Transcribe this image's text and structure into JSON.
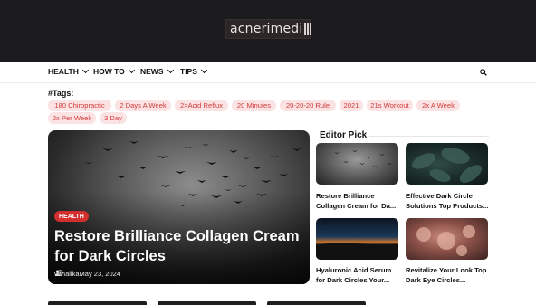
{
  "header": {
    "logo_text": "acnerimedi"
  },
  "nav": {
    "items": [
      {
        "label": "HEALTH"
      },
      {
        "label": "HOW TO"
      },
      {
        "label": "NEWS"
      },
      {
        "label": "TIPS"
      }
    ]
  },
  "tags": {
    "title": "#Tags:",
    "items": [
      "180 Chiropractic",
      "2 Days A Week",
      "2>Acid Reflux",
      "20 Minutes",
      "20-20-20 Rule",
      "2021",
      "21s Workout",
      "2x A Week",
      "2x Per Week",
      "3 Day"
    ]
  },
  "hero": {
    "category": "HEALTH",
    "title": "Restore Brilliance Collagen Cream for Dark Circles",
    "author": "vanalika",
    "date": "May 23, 2024"
  },
  "editor_pick": {
    "title": "Editor Pick",
    "cards": [
      {
        "title": "Restore Brilliance Collagen Cream for Da..."
      },
      {
        "title": "Effective Dark Circle Solutions Top Products..."
      },
      {
        "title": "Hyaluronic Acid Serum for Dark Circles Your..."
      },
      {
        "title": "Revitalize Your Look Top Dark Eye Circles..."
      }
    ]
  }
}
